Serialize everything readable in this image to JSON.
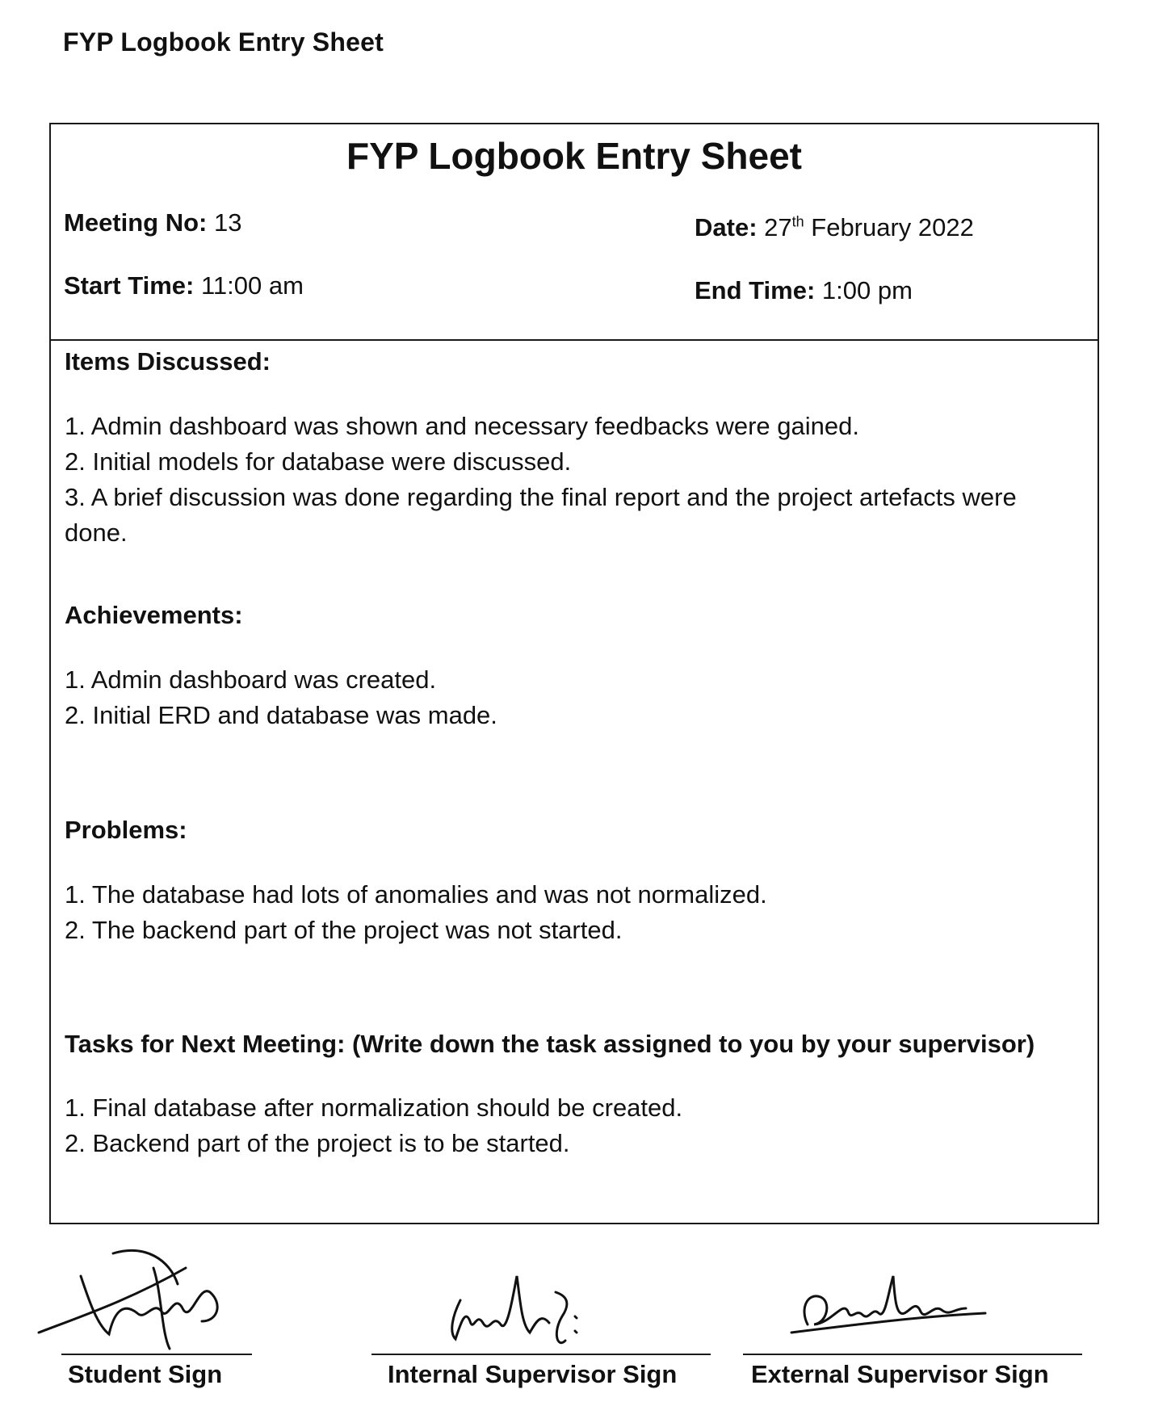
{
  "page_header": "FYP Logbook Entry Sheet",
  "sheet": {
    "title": "FYP Logbook Entry Sheet",
    "meeting_no_label": "Meeting No:",
    "meeting_no": "13",
    "date_label": "Date:",
    "date_day": "27",
    "date_suffix": "th",
    "date_rest": "February 2022",
    "start_time_label": "Start Time:",
    "start_time": "11:00 am",
    "end_time_label": "End Time:",
    "end_time": "1:00 pm"
  },
  "items_discussed": {
    "title": "Items Discussed:",
    "items": [
      "1. Admin dashboard was shown and necessary feedbacks were gained.",
      "2. Initial models for database were discussed.",
      "3. A brief discussion was done regarding the final report and the project artefacts were done."
    ]
  },
  "achievements": {
    "title": "Achievements:",
    "items": [
      "1. Admin dashboard was created.",
      "2. Initial ERD and database was made."
    ]
  },
  "problems": {
    "title": "Problems:",
    "items": [
      "1. The database had lots of anomalies and was not normalized.",
      "2. The backend part of the project was not started."
    ]
  },
  "tasks": {
    "title": "Tasks for Next Meeting: (Write down the task assigned to you by your supervisor)",
    "items": [
      "1. Final database after normalization should be created.",
      "2. Backend part of the project is to be started."
    ]
  },
  "signatures": {
    "student_label": "Student Sign",
    "internal_label": "Internal Supervisor Sign",
    "external_label": "External Supervisor Sign",
    "ink_color": "#111111"
  }
}
